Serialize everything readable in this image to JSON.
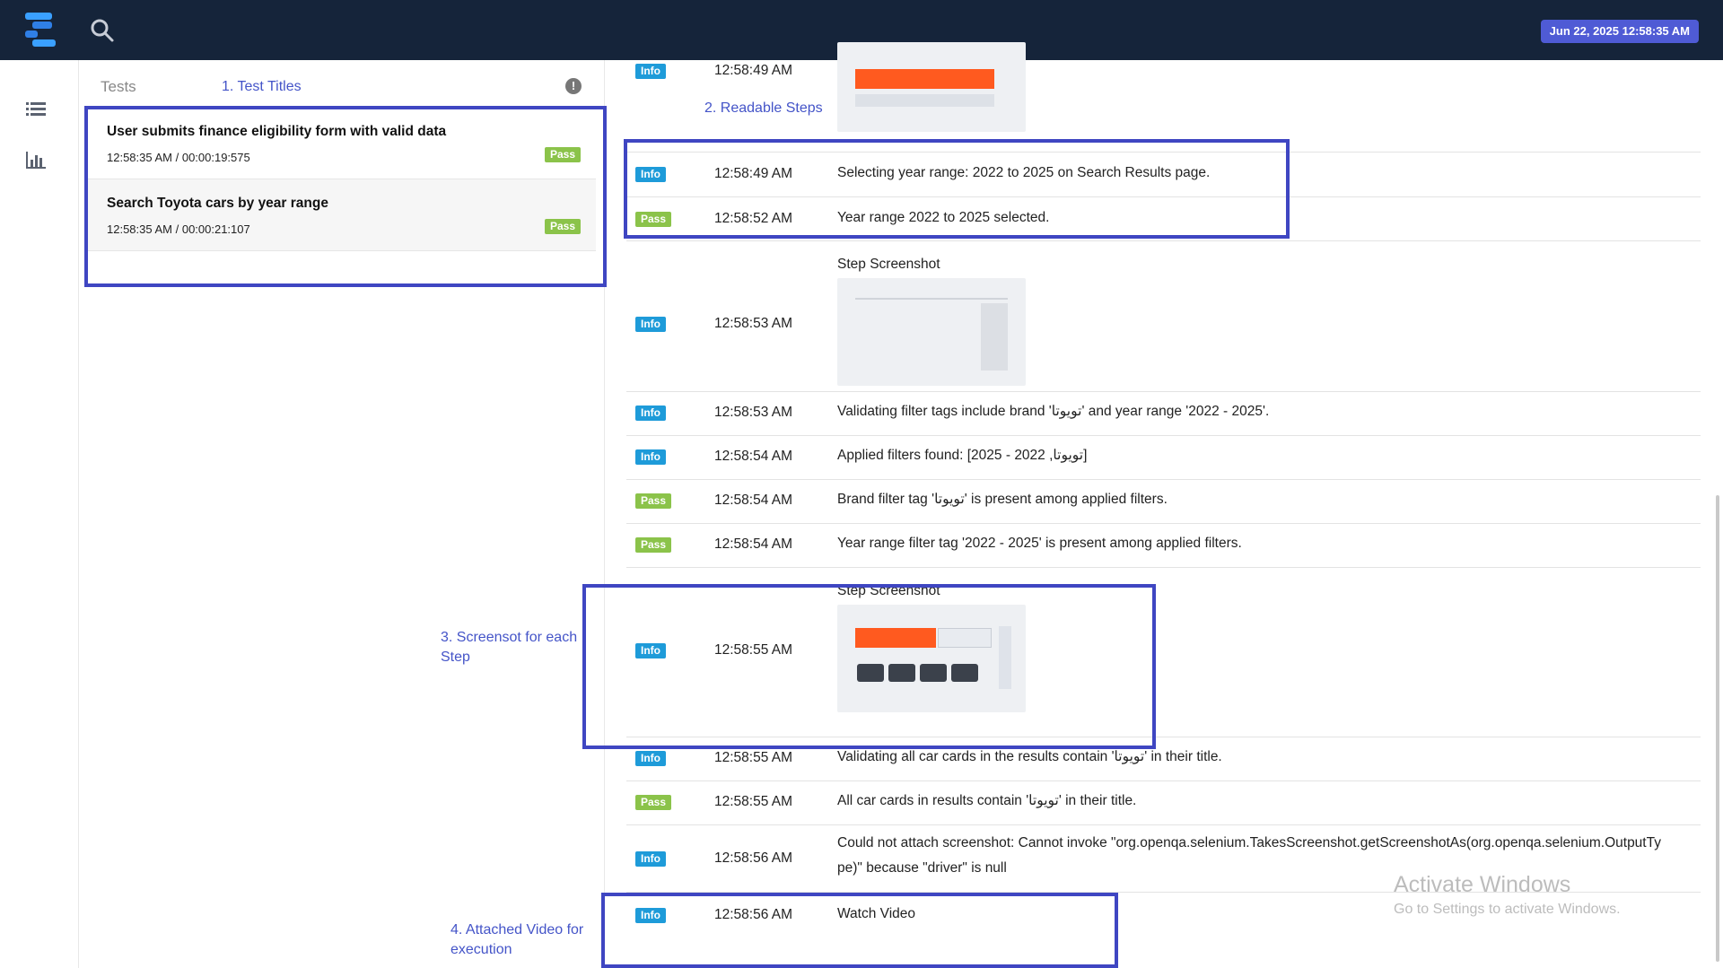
{
  "header": {
    "date": "Jun 22, 2025 12:58:35 AM"
  },
  "tests": {
    "header": "Tests",
    "items": [
      {
        "title": "User submits finance eligibility form with valid data",
        "meta": "12:58:35 AM / 00:00:19:575",
        "status": "Pass"
      },
      {
        "title": "Search Toyota cars by year range",
        "meta": "12:58:35 AM / 00:00:21:107",
        "status": "Pass"
      }
    ]
  },
  "annotations": {
    "a1": "1. Test Titles",
    "a2": "2. Readable Steps",
    "a3_line1": "3. Screensot for each",
    "a3_line2": "Step",
    "a4_line1": "4. Attached Video for",
    "a4_line2": "execution"
  },
  "steps": [
    {
      "status": "Info",
      "time": "12:58:49 AM",
      "screenshot": true,
      "label": ""
    },
    {
      "status": "Info",
      "time": "12:58:49 AM",
      "text": "Selecting year range: 2022 to 2025 on Search Results page."
    },
    {
      "status": "Pass",
      "time": "12:58:52 AM",
      "text": "Year range 2022 to 2025 selected."
    },
    {
      "status": "Info",
      "time": "12:58:53 AM",
      "label": "Step Screenshot"
    },
    {
      "status": "Info",
      "time": "12:58:53 AM",
      "text": "Validating filter tags include brand 'تويوتا' and year range '2022 - 2025'."
    },
    {
      "status": "Info",
      "time": "12:58:54 AM",
      "text": "Applied filters found: [2025 - 2022 ,تويوتا]"
    },
    {
      "status": "Pass",
      "time": "12:58:54 AM",
      "text": "Brand filter tag 'تويوتا' is present among applied filters."
    },
    {
      "status": "Pass",
      "time": "12:58:54 AM",
      "text": "Year range filter tag '2022 - 2025' is present among applied filters."
    },
    {
      "status": "Info",
      "time": "12:58:55 AM",
      "label": "Step Screenshot"
    },
    {
      "status": "Info",
      "time": "12:58:55 AM",
      "text": "Validating all car cards in the results contain 'تويوتا' in their title."
    },
    {
      "status": "Pass",
      "time": "12:58:55 AM",
      "text": "All car cards in results contain 'تويوتا' in their title."
    },
    {
      "status": "Info",
      "time": "12:58:56 AM",
      "text_line1": "Could not attach screenshot: Cannot invoke \"org.openqa.selenium.TakesScreenshot.getScreenshotAs(org.openqa.selenium.OutputTy",
      "text_line2": "pe)\" because \"driver\" is null"
    },
    {
      "status": "Info",
      "time": "12:58:56 AM",
      "link": "Watch Video"
    }
  ],
  "watermark": {
    "line1": "Activate Windows",
    "line2": "Go to Settings to activate Windows."
  },
  "colors": {
    "topbar": "#15243a",
    "date_badge": "#4f5bd5",
    "info": "#1e9bd9",
    "pass": "#8bc34a",
    "annotation": "#3f46c2",
    "link": "#1f7ed6"
  }
}
